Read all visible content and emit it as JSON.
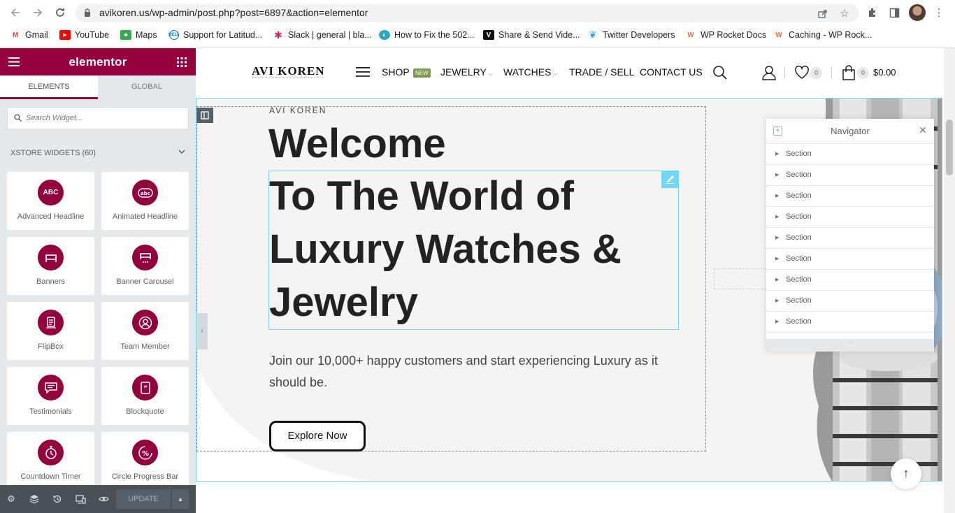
{
  "browser": {
    "url": "avikoren.us/wp-admin/post.php?post=6897&action=elementor",
    "bookmarks": [
      {
        "label": "Gmail",
        "icon": "gmail-icon"
      },
      {
        "label": "YouTube",
        "icon": "youtube-icon"
      },
      {
        "label": "Maps",
        "icon": "maps-icon"
      },
      {
        "label": "Support for Latitud...",
        "icon": "dell-icon"
      },
      {
        "label": "Slack | general | bla...",
        "icon": "slack-icon"
      },
      {
        "label": "How to Fix the 502...",
        "icon": "globe-icon"
      },
      {
        "label": "Share & Send Vide...",
        "icon": "v-icon"
      },
      {
        "label": "Twitter Developers",
        "icon": "twitter-icon"
      },
      {
        "label": "WP Rocket Docs",
        "icon": "wp-rocket-icon"
      },
      {
        "label": "Caching - WP Rock...",
        "icon": "wp-rocket-icon"
      }
    ]
  },
  "panel": {
    "logo": "elementor",
    "tabs": [
      "ELEMENTS",
      "GLOBAL"
    ],
    "search_placeholder": "Search Widget...",
    "category": "XSTORE WIDGETS (60)",
    "widgets": [
      {
        "label": "Advanced Headline",
        "icon": "abc-icon",
        "glyph": "ABC"
      },
      {
        "label": "Animated Headline",
        "icon": "animated-abc-icon",
        "glyph": "abc"
      },
      {
        "label": "Banners",
        "icon": "banner-icon",
        "glyph": ""
      },
      {
        "label": "Banner Carousel",
        "icon": "banner-carousel-icon",
        "glyph": ""
      },
      {
        "label": "FlipBox",
        "icon": "flipbox-icon",
        "glyph": ""
      },
      {
        "label": "Team Member",
        "icon": "person-icon",
        "glyph": ""
      },
      {
        "label": "Testimonials",
        "icon": "chat-icon",
        "glyph": ""
      },
      {
        "label": "Blockquote",
        "icon": "quote-icon",
        "glyph": ""
      },
      {
        "label": "Countdown Timer",
        "icon": "timer-icon",
        "glyph": ""
      },
      {
        "label": "Circle Progress Bar",
        "icon": "percent-icon",
        "glyph": "%"
      }
    ],
    "update_label": "UPDATE"
  },
  "site": {
    "logo": "AVI KOREN",
    "nav": {
      "shop": "SHOP",
      "new_badge": "NEW",
      "jewelry": "JEWELRY",
      "watches": "WATCHES",
      "trade": "TRADE / SELL",
      "contact": "CONTACT US"
    },
    "wishlist_count": "0",
    "cart_count": "0",
    "cart_total": "$0.00"
  },
  "hero": {
    "eyebrow": "AVI KOREN",
    "welcome": "Welcome",
    "headline": "To The World of Luxury Watches & Jewelry",
    "text": "Join our 10,000+ happy customers and start experiencing Luxury as it should be.",
    "button": "Explore Now"
  },
  "navigator": {
    "title": "Navigator",
    "rows": [
      "Section",
      "Section",
      "Section",
      "Section",
      "Section",
      "Section",
      "Section",
      "Section",
      "Section"
    ]
  },
  "colors": {
    "elementor_accent": "#93003c",
    "selection": "#71d7f7"
  }
}
